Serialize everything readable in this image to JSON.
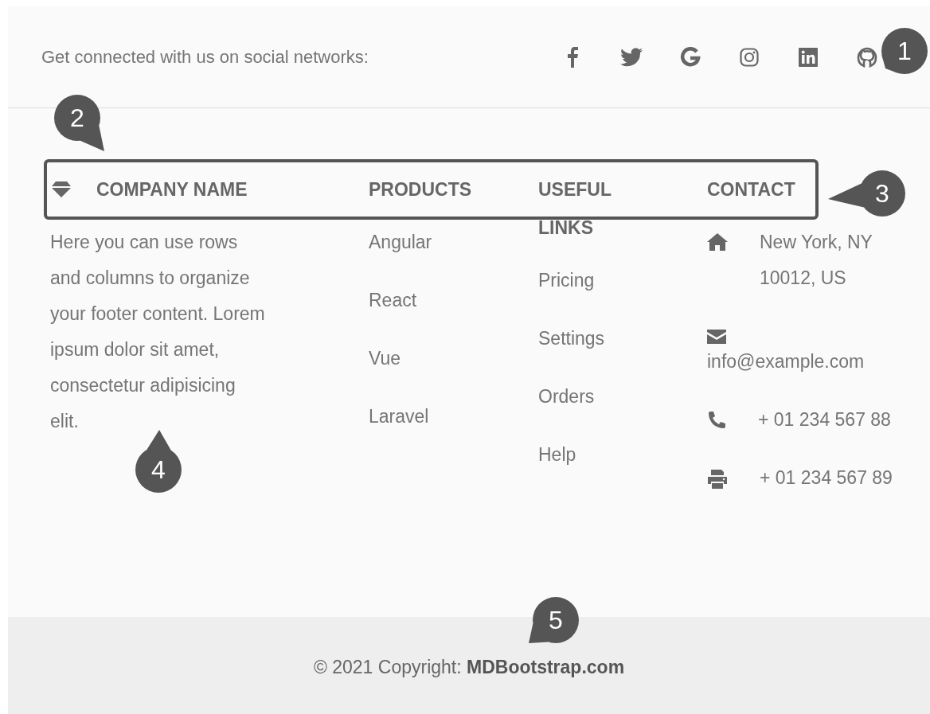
{
  "social_bar": {
    "text": "Get connected with us on social networks:"
  },
  "columns": [
    {
      "kind": "about",
      "title": "COMPANY NAME",
      "text": "Here you can use rows and columns to organize your footer content. Lorem ipsum dolor sit amet, consectetur adipisicing elit."
    },
    {
      "kind": "links",
      "title": "PRODUCTS",
      "links": [
        "Angular",
        "React",
        "Vue",
        "Laravel"
      ]
    },
    {
      "kind": "links",
      "title": "USEFUL LINKS",
      "links": [
        "Pricing",
        "Settings",
        "Orders",
        "Help"
      ]
    },
    {
      "kind": "contact",
      "title": "CONTACT",
      "items": [
        {
          "kind": "address",
          "text": "New York, NY 10012, US"
        },
        {
          "kind": "email",
          "text": "info@example.com"
        },
        {
          "kind": "phone",
          "text": "+ 01 234 567 88"
        },
        {
          "kind": "fax",
          "text": "+ 01 234 567 89"
        }
      ]
    }
  ],
  "copyright": {
    "text": "© 2021 Copyright: **MDBootstrap.com**"
  },
  "callouts": [
    "1",
    "2",
    "3",
    "4",
    "5"
  ]
}
